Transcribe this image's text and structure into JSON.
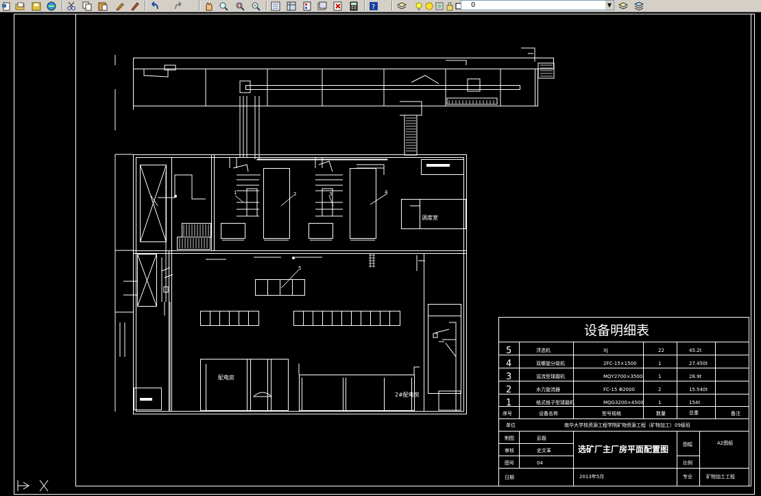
{
  "toolbar": {
    "icons": [
      "new-icon",
      "open-icon",
      "save-icon",
      "publish-icon",
      "cut-icon",
      "copy-icon",
      "paste-icon",
      "match-properties-icon",
      "brush-icon",
      "undo-icon",
      "redo-icon",
      "pan-icon",
      "zoom-realtime-icon",
      "zoom-window-icon",
      "zoom-previous-icon",
      "properties-icon",
      "design-center-icon",
      "tool-palettes-icon",
      "sheet-set-icon",
      "markup-icon",
      "calculator-icon",
      "help-icon",
      "layer-manager-icon",
      "lightbulb-icon",
      "sun-icon",
      "freeze-icon",
      "lock-icon",
      "color-icon"
    ],
    "layer_name": "0"
  },
  "drawing": {
    "table_title": "设备明细表",
    "rooms": {
      "control_room": "调度室",
      "power_room": "配电房",
      "power_room_2": "2#配电房"
    },
    "equipment_callouts": [
      "1",
      "2",
      "3",
      "4",
      "5"
    ],
    "equipment_rows": [
      {
        "no": "5",
        "name": "浮选机",
        "model": "XJ",
        "qty": "22",
        "weight": "45.2t"
      },
      {
        "no": "4",
        "name": "双螺旋分级机",
        "model": "2FC-15×1500",
        "qty": "1",
        "weight": "27.450t"
      },
      {
        "no": "3",
        "name": "溢流型球磨机",
        "model": "MQY2700×3500",
        "qty": "1",
        "weight": "28.9t"
      },
      {
        "no": "2",
        "name": "水力旋流器",
        "model": "FC-15 Φ2000",
        "qty": "2",
        "weight": "15.540t"
      },
      {
        "no": "1",
        "name": "格式格子型球磨机",
        "model": "MQG3200×4500",
        "qty": "1",
        "weight": "154t"
      }
    ],
    "table_header": {
      "no": "序号",
      "name": "设备名称",
      "model": "型号规格",
      "qty": "数量",
      "weight": "总重",
      "remark": "备注"
    },
    "unit_label": "单位",
    "unit_value": "南华大学核资源工程学院矿物资源工程（矿物加工）09级班",
    "drawn_by_label": "制图",
    "drawn_by": "彭磊",
    "reviewed_by_label": "审核",
    "reviewed_by": "史文革",
    "sheet_no_label": "图号",
    "sheet_no": "04",
    "drawing_title": "选矿厂主厂房平面配置图",
    "paper_label": "图幅",
    "paper_value": "A2图纸",
    "scale_label": "比例",
    "date_label": "日期",
    "date_value": "2013年5月",
    "major_label": "专业",
    "major_value": "矿物加工工程"
  }
}
